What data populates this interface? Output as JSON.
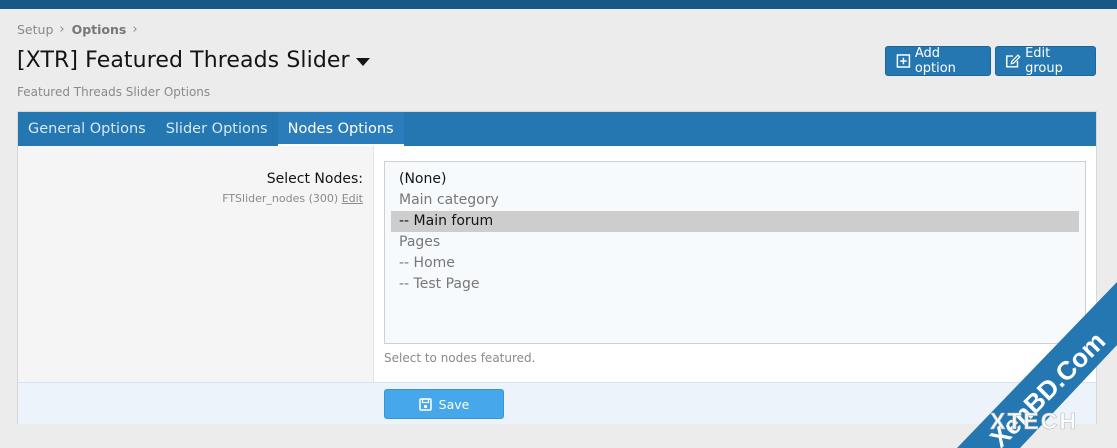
{
  "breadcrumb": {
    "items": [
      "Setup",
      "Options"
    ]
  },
  "page": {
    "title": "[XTR] Featured Threads Slider",
    "subtitle": "Featured Threads Slider Options"
  },
  "actions": {
    "add_option": "Add option",
    "edit_group": "Edit group"
  },
  "tabs": [
    {
      "label": "General Options",
      "active": false
    },
    {
      "label": "Slider Options",
      "active": false
    },
    {
      "label": "Nodes Options",
      "active": true
    }
  ],
  "field": {
    "label": "Select Nodes:",
    "option_id": "FTSlider_nodes (300)",
    "edit_link": "Edit",
    "options": [
      "(None)",
      "Main category",
      "-- Main forum",
      "Pages",
      "-- Home",
      "-- Test Page"
    ],
    "selected": "-- Main forum",
    "explain": "Select to nodes featured."
  },
  "footer": {
    "save_label": "Save"
  },
  "watermark": {
    "brand": "XenBD.Com",
    "sub": "XTECH"
  },
  "colors": {
    "accent": "#2577b1",
    "header": "#185886",
    "save": "#47a7eb",
    "selected": "#cdcdcd"
  },
  "icons": {
    "add": "plus-square-icon",
    "edit": "edit-icon",
    "save": "save-icon",
    "caret": "caret-down-icon"
  }
}
